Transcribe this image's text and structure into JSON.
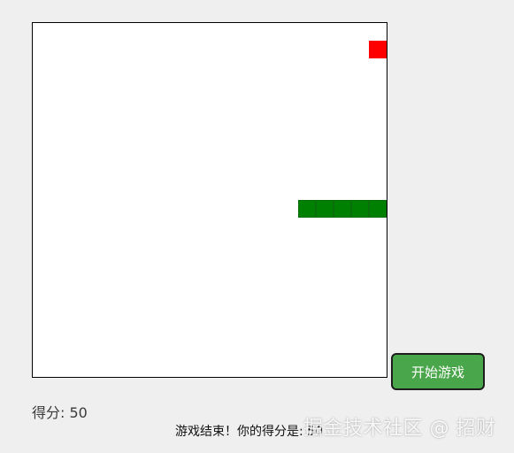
{
  "game": {
    "score_text": "得分: 50",
    "game_over_text": "游戏结束！你的得分是: 50",
    "start_button_label": "开始游戏",
    "grid": {
      "cols": 20,
      "rows": 20
    },
    "snake": [
      {
        "col": 15,
        "row": 10
      },
      {
        "col": 16,
        "row": 10
      },
      {
        "col": 17,
        "row": 10
      },
      {
        "col": 18,
        "row": 10
      },
      {
        "col": 19,
        "row": 10
      }
    ],
    "food": {
      "col": 19,
      "row": 1
    },
    "colors": {
      "snake": "#008000",
      "food": "#ff0000",
      "button": "#4aa64a",
      "board": "#ffffff",
      "page": "#efefef"
    }
  },
  "watermark": {
    "text": "掘金技术社区 @ 招财"
  }
}
